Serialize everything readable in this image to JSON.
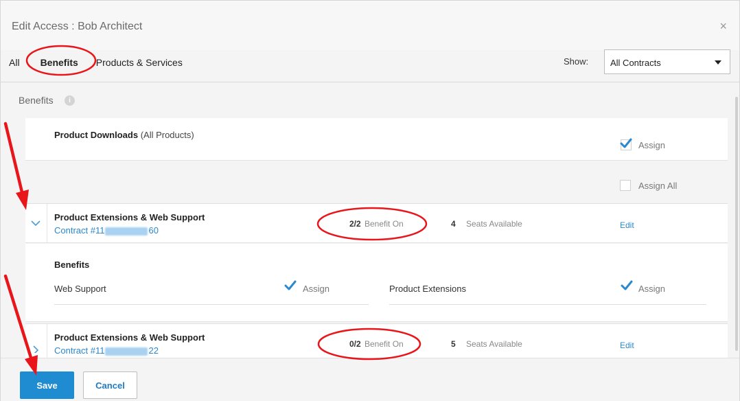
{
  "dialog": {
    "title_prefix": "Edit Access",
    "title_separator": ":",
    "title_user": "Bob Architect",
    "close_icon": "×"
  },
  "tabs": [
    {
      "label": "All"
    },
    {
      "label": "Benefits",
      "active": true
    },
    {
      "label": "Products & Services"
    }
  ],
  "filter": {
    "show_label": "Show:",
    "selected": "All Contracts"
  },
  "section": {
    "title": "Benefits",
    "info_icon": "i"
  },
  "product_downloads": {
    "name": "Product Downloads",
    "qualifier": "(All Products)",
    "assign_label": "Assign",
    "assigned": true
  },
  "assign_all": {
    "label": "Assign All",
    "checked": false
  },
  "contracts": [
    {
      "name": "Product Extensions & Web Support",
      "contract_prefix": "Contract #11",
      "contract_suffix": "60",
      "benefit_ratio": "2/2",
      "benefit_label": "Benefit On",
      "seats": "4",
      "seats_label": "Seats Available",
      "edit_label": "Edit",
      "expanded": true
    },
    {
      "name": "Product Extensions & Web Support",
      "contract_prefix": "Contract #11",
      "contract_suffix": "22",
      "benefit_ratio": "0/2",
      "benefit_label": "Benefit On",
      "seats": "5",
      "seats_label": "Seats Available",
      "edit_label": "Edit",
      "expanded": false
    }
  ],
  "benefits_panel": {
    "heading": "Benefits",
    "items": [
      {
        "name": "Web Support",
        "assign_label": "Assign",
        "assigned": true
      },
      {
        "name": "Product Extensions",
        "assign_label": "Assign",
        "assigned": true
      }
    ]
  },
  "footer": {
    "save_label": "Save",
    "cancel_label": "Cancel"
  },
  "colors": {
    "accent": "#1f8bd0",
    "link": "#2a88cf",
    "annotation": "#e8161b"
  }
}
